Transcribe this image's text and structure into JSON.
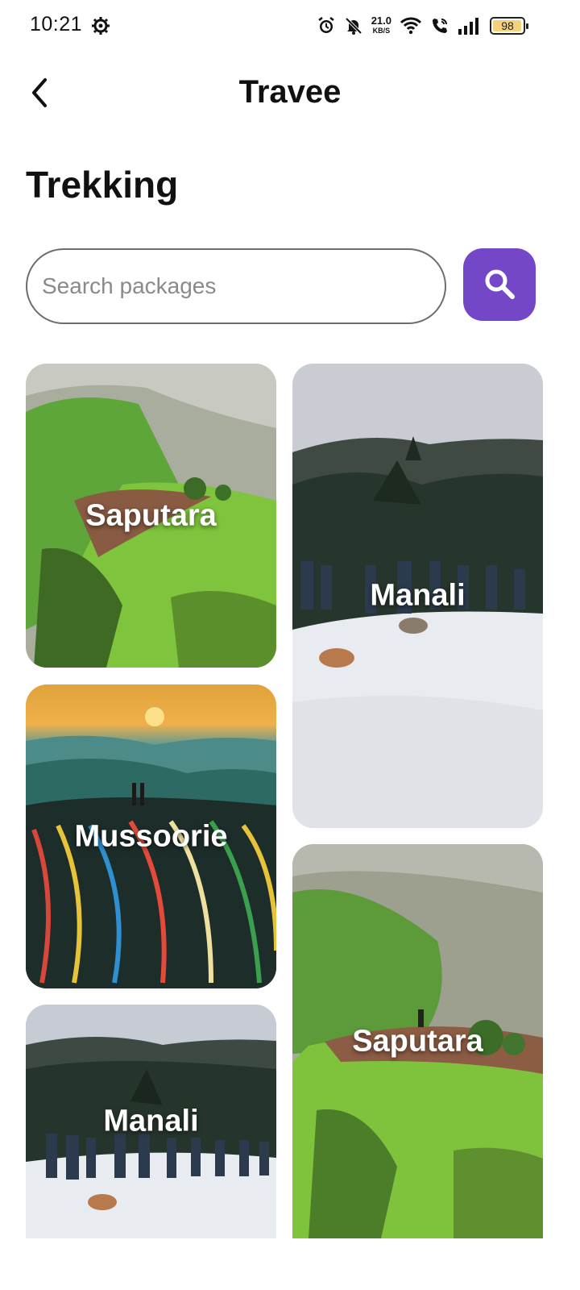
{
  "status_bar": {
    "time": "10:21",
    "net_speed_value": "21.0",
    "net_speed_unit": "KB/S",
    "battery": "98",
    "battery_level": 0.98,
    "battery_color": "#f5d27a"
  },
  "header": {
    "title": "Travee"
  },
  "section": {
    "title": "Trekking"
  },
  "search": {
    "placeholder": "Search packages",
    "button_color": "#7447c8"
  },
  "cards": [
    {
      "label": "Saputara",
      "scene": "green-cliff"
    },
    {
      "label": "Manali",
      "scene": "snow-trek"
    },
    {
      "label": "Mussoorie",
      "scene": "sunset-flags"
    },
    {
      "label": "Saputara",
      "scene": "green-cliff"
    },
    {
      "label": "Manali",
      "scene": "snow-trek"
    }
  ],
  "icons": {
    "back": "chevron-left-icon",
    "search": "search-icon",
    "settings": "gear-icon",
    "alarm": "alarm-icon",
    "mute": "bell-off-icon",
    "wifi": "wifi-icon",
    "call": "wifi-call-icon",
    "signal": "signal-icon"
  }
}
